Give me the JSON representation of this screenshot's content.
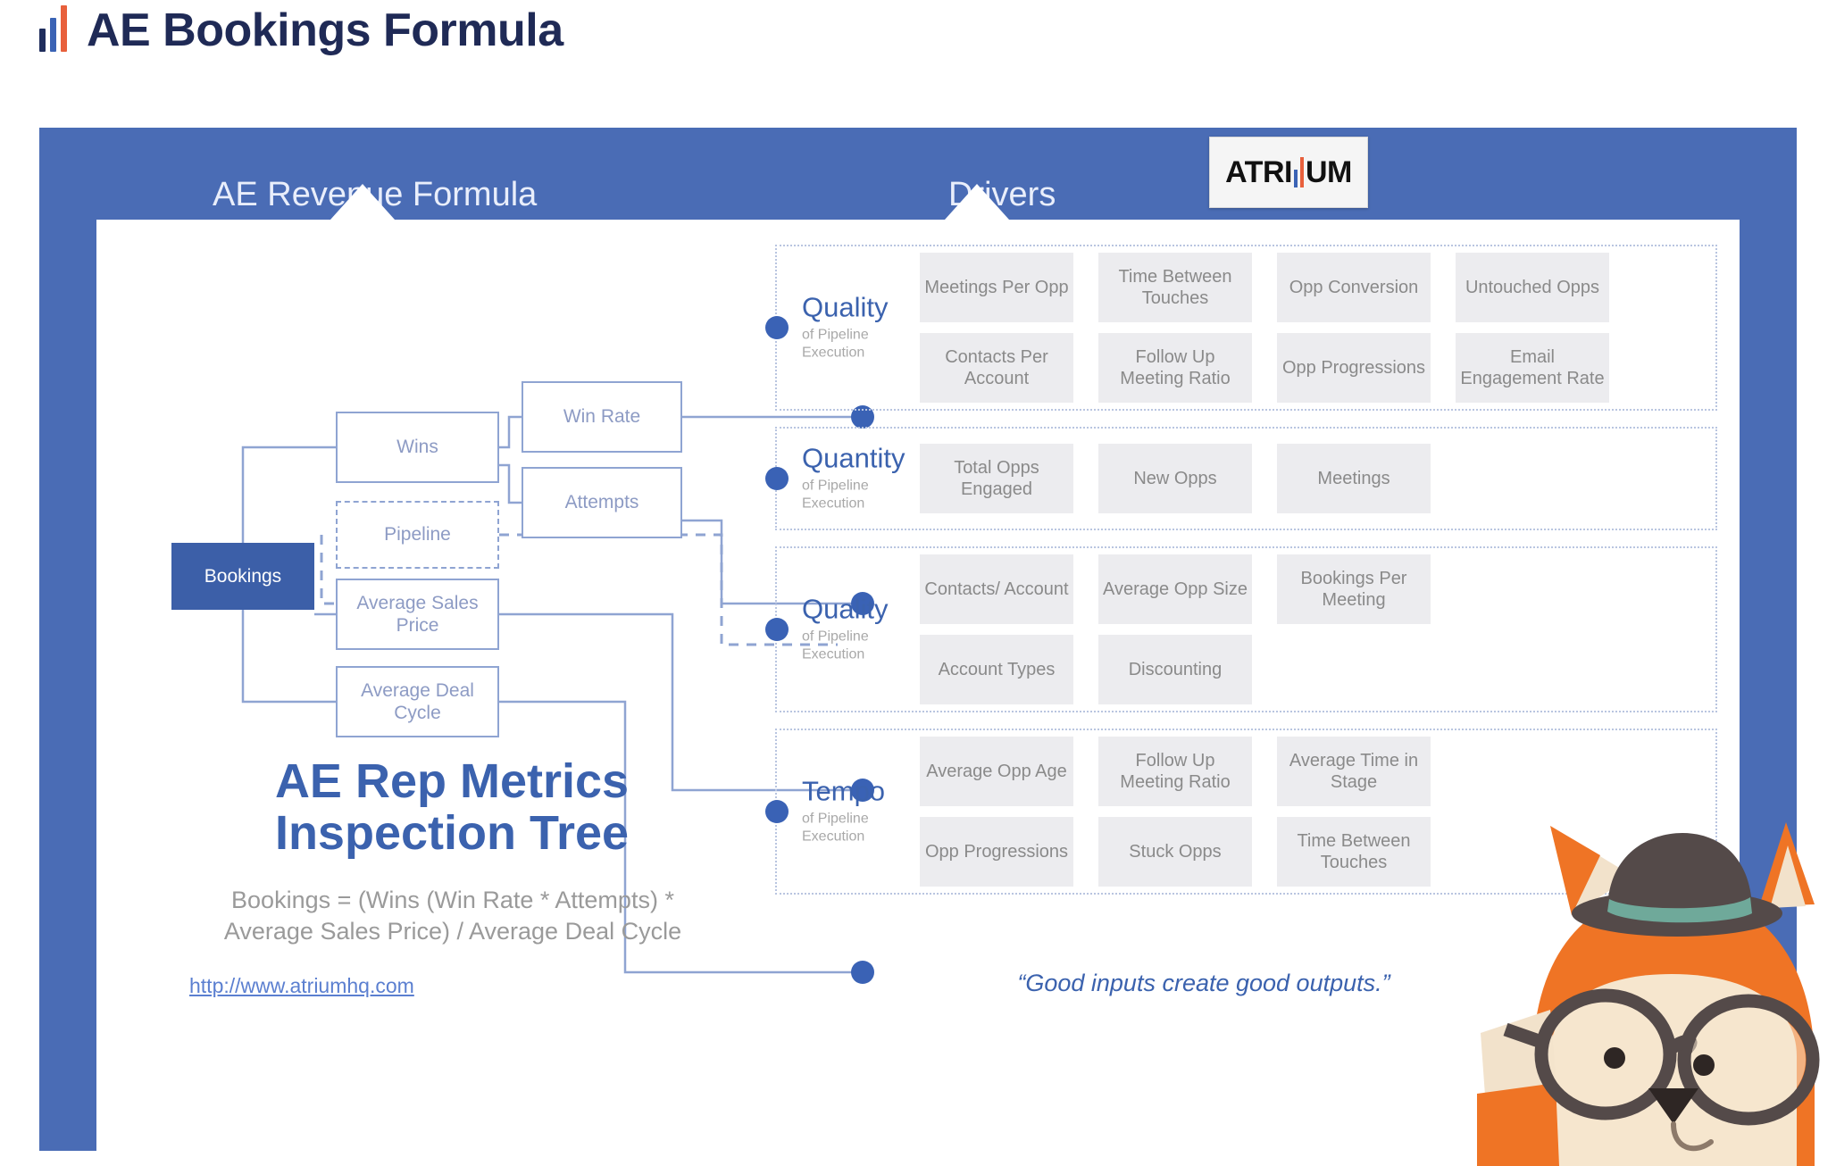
{
  "page": {
    "title": "AE Bookings Formula",
    "logo_icon": "bar-chart-icon"
  },
  "panel": {
    "header_left": "AE Revenue Formula",
    "header_right": "Drivers",
    "brand": {
      "text_before": "ATRI",
      "text_after": "UM",
      "full": "ATRIUM"
    }
  },
  "tree": {
    "root": "Bookings",
    "nodes": {
      "wins": "Wins",
      "pipeline": "Pipeline",
      "average_sales_price": "Average Sales\nPrice",
      "average_deal_cycle": "Average Deal\nCycle",
      "win_rate": "Win Rate",
      "attempts": "Attempts"
    },
    "asp_line1": "Average Sales",
    "asp_line2": "Price",
    "adc_line1": "Average Deal",
    "adc_line2": "Cycle"
  },
  "footer": {
    "big_title_line1": "AE Rep Metrics",
    "big_title_line2": "Inspection Tree",
    "formula_line1": "Bookings = (Wins (Win Rate * Attempts) *",
    "formula_line2": "Average Sales Price) / Average Deal Cycle",
    "link": "http://www.atriumhq.com",
    "quote": "“Good inputs create good outputs.”"
  },
  "sections": [
    {
      "title": "Quality",
      "subtitle_line1": "of Pipeline",
      "subtitle_line2": "Execution",
      "tiles": [
        "Meetings Per Opp",
        "Time Between Touches",
        "Opp Conversion",
        "Untouched Opps",
        "Contacts Per Account",
        "Follow Up Meeting Ratio",
        "Opp Progressions",
        "Email Engagement Rate"
      ]
    },
    {
      "title": "Quantity",
      "subtitle_line1": "of Pipeline",
      "subtitle_line2": "Execution",
      "tiles": [
        "Total Opps Engaged",
        "New Opps",
        "Meetings"
      ]
    },
    {
      "title": "Quality",
      "subtitle_line1": "of Pipeline",
      "subtitle_line2": "Execution",
      "tiles": [
        "Contacts/ Account",
        "Average Opp Size",
        "Bookings Per Meeting",
        "Account Types",
        "Discounting"
      ]
    },
    {
      "title": "Tempo",
      "subtitle_line1": "of Pipeline",
      "subtitle_line2": "Execution",
      "tiles": [
        "Average Opp Age",
        "Follow Up Meeting Ratio",
        "Average Time in Stage",
        "Opp Progressions",
        "Stuck Opps",
        "Time Between Touches"
      ]
    }
  ],
  "colors": {
    "panel_blue": "#4a6cb5",
    "root_blue": "#3c5fa8",
    "accent_blue": "#3b62ae",
    "node_border": "#8fa4d2",
    "tile_bg": "#ececef",
    "tile_text": "#8a8a8a",
    "orange": "#e8603c"
  },
  "mascot": {
    "name": "fox-mascot"
  }
}
